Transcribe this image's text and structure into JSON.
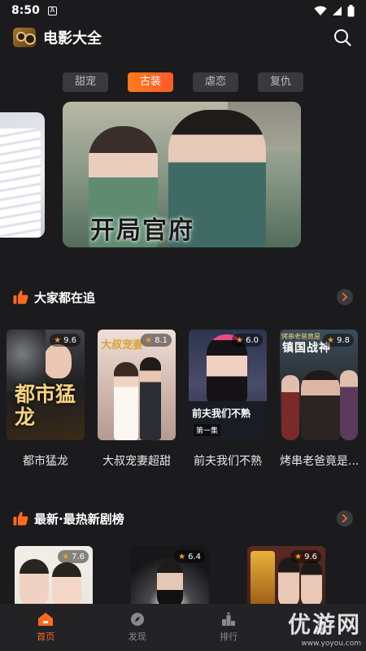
{
  "status_bar": {
    "time": "8:50",
    "notification": "A"
  },
  "app": {
    "title": "电影大全"
  },
  "tabs": [
    {
      "label": "甜宠",
      "active": false
    },
    {
      "label": "古装",
      "active": true
    },
    {
      "label": "虐恋",
      "active": false
    },
    {
      "label": "复仇",
      "active": false
    }
  ],
  "banner": {
    "caption": "开局官府"
  },
  "section_trending": {
    "title": "大家都在追",
    "items": [
      {
        "title": "都市猛龙",
        "rating": "9.6",
        "poster_text": "都市猛龙"
      },
      {
        "title": "大叔宠妻超甜",
        "rating": "8.1",
        "poster_text": "大叔宠妻"
      },
      {
        "title": "前夫我们不熟",
        "rating": "6.0",
        "poster_text": "前夫我们不熟",
        "poster_sub": "第一集"
      },
      {
        "title": "烤串老爸竟是...",
        "rating": "9.8",
        "poster_text": "镇国战神",
        "poster_sub": "烤串老爸竟是"
      }
    ]
  },
  "section_new": {
    "title": "最新·最热新剧榜",
    "items": [
      {
        "rating": "7.6"
      },
      {
        "rating": "6.4"
      },
      {
        "rating": "9.6"
      }
    ]
  },
  "bottom_nav": [
    {
      "label": "首页",
      "icon": "home-icon",
      "active": true
    },
    {
      "label": "发现",
      "icon": "compass-icon",
      "active": false
    },
    {
      "label": "排行",
      "icon": "ranking-icon",
      "active": false
    },
    {
      "label": "",
      "icon": "profile-icon",
      "active": false
    }
  ],
  "watermark": {
    "big": "优游网",
    "small": "www.yoyou.com"
  },
  "colors": {
    "accent": "#ff6a1f",
    "background": "#1b1b1d",
    "tab_inactive": "#3a3a3d"
  }
}
